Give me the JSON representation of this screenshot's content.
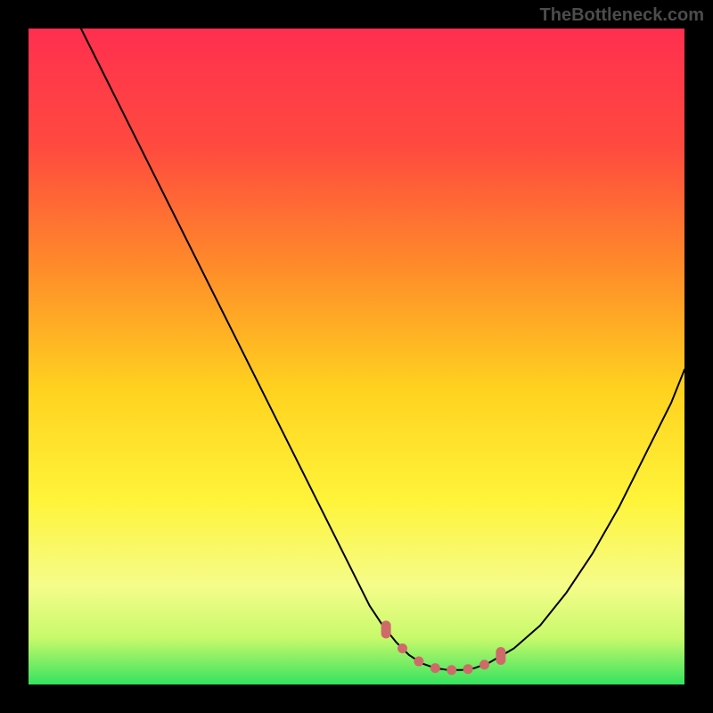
{
  "watermark": "TheBottleneck.com",
  "chart_data": {
    "type": "line",
    "title": "",
    "xlabel": "",
    "ylabel": "",
    "xlim": [
      0,
      100
    ],
    "ylim": [
      0,
      100
    ],
    "grid": false,
    "legend": false,
    "series": [
      {
        "name": "curve",
        "color": "#000000",
        "x": [
          8,
          12,
          16,
          20,
          24,
          28,
          32,
          36,
          40,
          44,
          48,
          52,
          54,
          56,
          58,
          60,
          62,
          64,
          66,
          68,
          70,
          74,
          78,
          82,
          86,
          90,
          94,
          98,
          100
        ],
        "values": [
          100,
          92,
          84,
          76,
          68,
          60,
          52,
          44,
          36,
          28,
          20,
          12,
          9,
          6.5,
          4.5,
          3.2,
          2.5,
          2.2,
          2.2,
          2.5,
          3.2,
          5.5,
          9,
          14,
          20,
          27,
          35,
          43,
          48
        ]
      }
    ],
    "highlight_band": {
      "color_top": "#f7fca0",
      "color_bottom": "#35e35e",
      "y_range_pct": [
        0,
        18
      ]
    },
    "bottom_markers": {
      "color": "#cf6a6a",
      "shape": "rounded-pill",
      "x_positions_pct": [
        54.5,
        57,
        59.5,
        62,
        64.5,
        67,
        69.5,
        72
      ]
    },
    "gradient_stops": [
      {
        "offset": 0.0,
        "color": "#ff2f4f"
      },
      {
        "offset": 0.18,
        "color": "#ff4a3f"
      },
      {
        "offset": 0.36,
        "color": "#ff8a2a"
      },
      {
        "offset": 0.55,
        "color": "#ffd21f"
      },
      {
        "offset": 0.72,
        "color": "#fff43a"
      },
      {
        "offset": 0.85,
        "color": "#f5fc8a"
      },
      {
        "offset": 0.93,
        "color": "#c7f96b"
      },
      {
        "offset": 1.0,
        "color": "#35e35e"
      }
    ]
  }
}
